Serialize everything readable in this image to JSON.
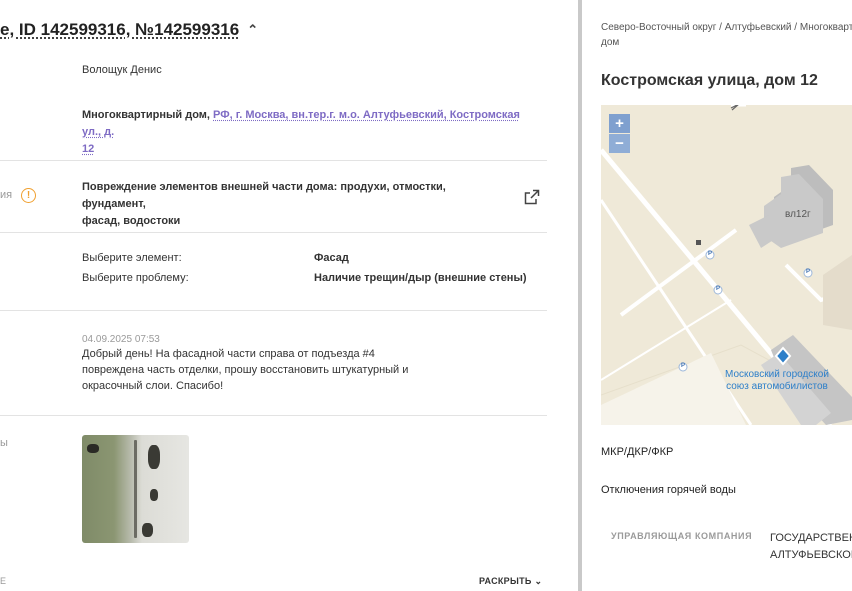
{
  "header": {
    "title": "e, ID 142599316, №142599316"
  },
  "applicant": {
    "name": "Волощук Денис"
  },
  "object": {
    "type": "Многоквартирный дом,",
    "address_line1": "РФ, г. Москва, вн.тер.г. м.о. Алтуфьевский, Костромская ул., д.",
    "address_line2": "12"
  },
  "category": {
    "label": "ия",
    "line1": "Повреждение элементов внешней части дома: продухи, отмостки, фундамент,",
    "line2": "фасад, водостоки"
  },
  "details": [
    {
      "label": "Выберите элемент:",
      "value": "Фасад"
    },
    {
      "label": "Выберите проблему:",
      "value": "Наличие трещин/дыр (внешние стены)"
    }
  ],
  "message": {
    "timestamp": "04.09.2025 07:53",
    "line1": "Добрый день! На фасадной части справа от подъезда #4",
    "line2": "повреждена часть отделки, прошу восстановить штукатурный и",
    "line3": "окрасочный слои. Спасибо!"
  },
  "photos": {
    "label": "ы"
  },
  "footer": {
    "left_fragment": "Е",
    "expand_label": "РАСКРЫТЬ"
  },
  "right_panel": {
    "breadcrumb_line1": "Северо-Восточный округ / Алтуфьевский / Многоквартирный",
    "breadcrumb_line2": "дом",
    "address": "Костромская улица, дом 12",
    "map": {
      "zoom_in": "+",
      "zoom_out": "−",
      "building_label": "вл12г",
      "poi_line1": "Московский городской",
      "poi_line2": "союз автомобилистов",
      "parking": "P",
      "colors": {
        "land": "#efe9d8",
        "road": "#ffffff",
        "building": "#c8c8c8",
        "poi": "#2d7fc9"
      }
    },
    "mkr_label": "МКР/ДКР/ФКР",
    "hot_water_label": "Отключения горячей воды",
    "management_label": "УПРАВЛЯЮЩАЯ КОМПАНИЯ",
    "management_value_line1": "ГОСУДАРСТВЕННОЕ",
    "management_value_line2": "АЛТУФЬЕВСКОГО"
  }
}
